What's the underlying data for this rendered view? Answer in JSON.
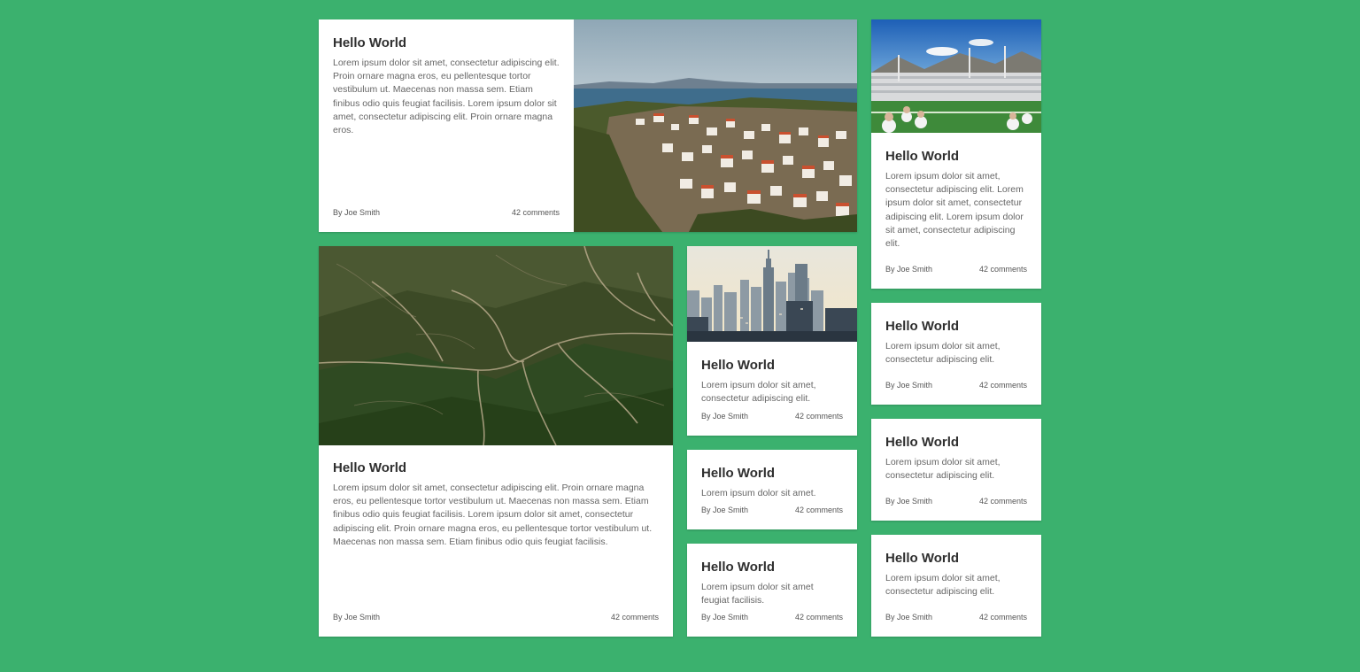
{
  "cards": [
    {
      "title": "Hello World",
      "text": "Lorem ipsum dolor sit amet, consectetur adipiscing elit. Proin ornare magna eros, eu pellentesque tortor vestibulum ut. Maecenas non massa sem. Etiam finibus odio quis feugiat facilisis. Lorem ipsum dolor sit amet, consectetur adipiscing elit. Proin ornare magna eros.",
      "author": "By Joe Smith",
      "comments": "42 comments",
      "image": "coastal-town-photo"
    },
    {
      "title": "Hello World",
      "text": "Lorem ipsum dolor sit amet, consectetur adipiscing elit. Lorem ipsum dolor sit amet, consectetur adipiscing elit. Lorem ipsum dolor sit amet, consectetur adipiscing elit.",
      "author": "By Joe Smith",
      "comments": "42 comments",
      "image": "stadium-photo"
    },
    {
      "title": "Hello World",
      "text": "Lorem ipsum dolor sit amet, consectetur adipiscing elit. Proin ornare magna eros, eu pellentesque tortor vestibulum ut. Maecenas non massa sem. Etiam finibus odio quis feugiat facilisis. Lorem ipsum dolor sit amet, consectetur adipiscing elit. Proin ornare magna eros, eu pellentesque tortor vestibulum ut. Maecenas non massa sem. Etiam finibus odio quis feugiat facilisis.",
      "author": "By Joe Smith",
      "comments": "42 comments",
      "image": "aerial-landscape-photo"
    },
    {
      "title": "Hello World",
      "text": "Lorem ipsum dolor sit amet, consectetur adipiscing elit.",
      "author": "By Joe Smith",
      "comments": "42 comments",
      "image": "city-skyline-photo"
    },
    {
      "title": "Hello World",
      "text": "Lorem ipsum dolor sit amet.",
      "author": "By Joe Smith",
      "comments": "42 comments"
    },
    {
      "title": "Hello World",
      "text": "Lorem ipsum dolor sit amet feugiat facilisis.",
      "author": "By Joe Smith",
      "comments": "42 comments"
    },
    {
      "title": "Hello World",
      "text": "Lorem ipsum dolor sit amet, consectetur adipiscing elit.",
      "author": "By Joe Smith",
      "comments": "42 comments"
    },
    {
      "title": "Hello World",
      "text": "Lorem ipsum dolor sit amet, consectetur adipiscing elit.",
      "author": "By Joe Smith",
      "comments": "42 comments"
    },
    {
      "title": "Hello World",
      "text": "Lorem ipsum dolor sit amet, consectetur adipiscing elit.",
      "author": "By Joe Smith",
      "comments": "42 comments"
    }
  ],
  "colors": {
    "background": "#3bb16e",
    "card": "#ffffff",
    "title": "#2f2f2f",
    "text": "#666666"
  }
}
